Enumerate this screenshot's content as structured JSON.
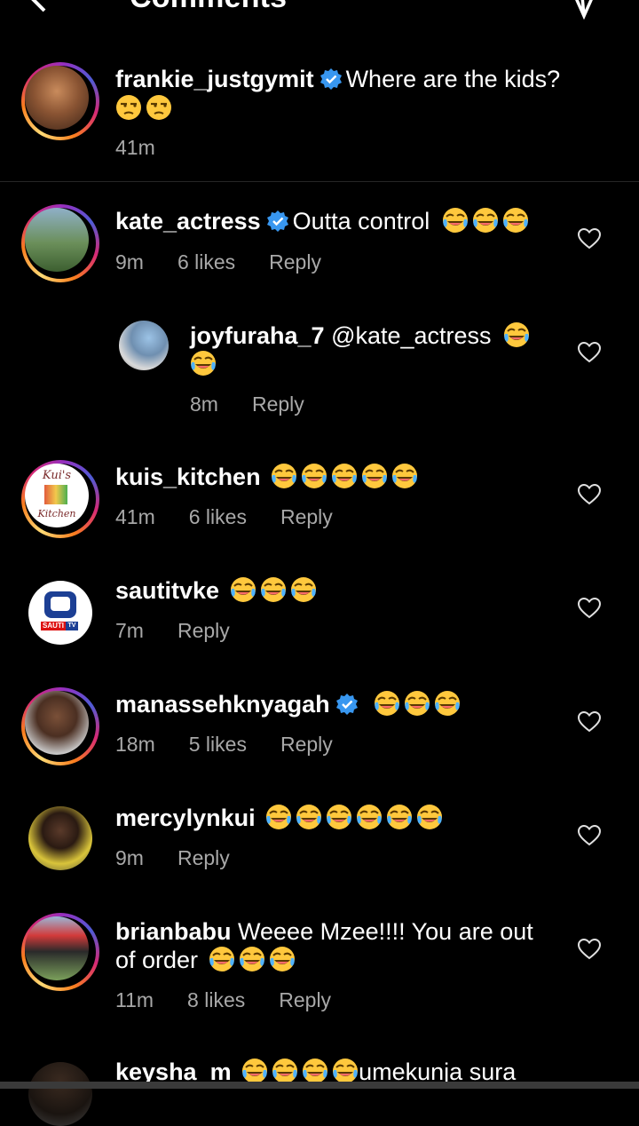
{
  "header": {
    "title": "Comments"
  },
  "caption": {
    "username": "frankie_justgymit",
    "text": "Where are the kids?",
    "emoji_count": 2,
    "time": "41m"
  },
  "comments": [
    {
      "username": "kate_actress",
      "text": "Outta control",
      "emoji_count": 3,
      "time": "9m",
      "likes": "6 likes",
      "reply": "Reply"
    },
    {
      "username": "joyfuraha_7",
      "text": "@kate_actress",
      "emoji_count": 2,
      "time": "8m",
      "reply": "Reply"
    },
    {
      "username": "kuis_kitchen",
      "emoji_count": 5,
      "time": "41m",
      "likes": "6 likes",
      "reply": "Reply"
    },
    {
      "username": "sautitvke",
      "emoji_count": 3,
      "time": "7m",
      "reply": "Reply"
    },
    {
      "username": "manassehknyagah",
      "emoji_count": 3,
      "time": "18m",
      "likes": "5 likes",
      "reply": "Reply"
    },
    {
      "username": "mercylynkui",
      "emoji_count": 6,
      "time": "9m",
      "reply": "Reply"
    },
    {
      "username": "brianbabu",
      "text_line1": "Weeee Mzee!!!! You are out",
      "text_line2": "of order",
      "emoji_count": 3,
      "time": "11m",
      "likes": "8 likes",
      "reply": "Reply"
    },
    {
      "username": "keysha_m",
      "text": "umekunja sura",
      "emoji_count": 4
    }
  ],
  "colors": {
    "background": "#000000",
    "meta_text": "#a8a8a8",
    "verified": "#3897f0"
  },
  "icons": [
    "back-arrow-icon",
    "send-icon",
    "verified-badge-icon",
    "heart-icon",
    "laughing-emoji-icon",
    "unamused-emoji-icon"
  ]
}
